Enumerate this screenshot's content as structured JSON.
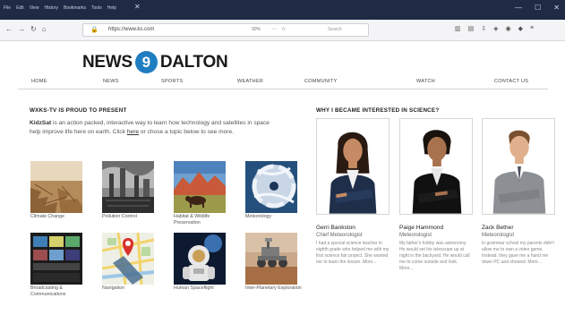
{
  "browser": {
    "menu": [
      "File",
      "Edit",
      "View",
      "History",
      "Bookmarks",
      "Tools",
      "Help"
    ],
    "url": "https://www.ks.com",
    "zoom": "90%",
    "search_placeholder": "Search"
  },
  "site": {
    "logo_word1": "NEWS",
    "logo_number": "9",
    "logo_word2": "DALTON",
    "nav": [
      "HOME",
      "NEWS",
      "SPORTS",
      "WEATHER",
      "COMMUNITY",
      "WATCH",
      "CONTACT US"
    ]
  },
  "left": {
    "heading": "WXKS-TV IS PROUD TO PRESENT",
    "intro_bold": "KidzSat",
    "intro_1": " is an action packed, interactive way to learn how technology and satellites in space help improve life here on earth. Click ",
    "intro_link": "here",
    "intro_2": " or chose a topic below to see more.",
    "topics": [
      {
        "label": "Climate Change"
      },
      {
        "label": "Pollution Control"
      },
      {
        "label": "Habitat & Wildlife Preservation"
      },
      {
        "label": "Meteorology"
      },
      {
        "label": "Broadcasting & Communications"
      },
      {
        "label": "Navigation"
      },
      {
        "label": "Human Spaceflight"
      },
      {
        "label": "Inter-Planetary Exploration"
      }
    ]
  },
  "right": {
    "heading": "WHY I BECAME INTERESTED IN SCIENCE?",
    "people": [
      {
        "name": "Gerri Bankston",
        "title": "Chief Meteorologist",
        "bio": "I had a special science teacher in eighth grade who helped me with my first science fair project. She wanted me to learn the lesson. More..."
      },
      {
        "name": "Paige Hammond",
        "title": "Meteorologist",
        "bio": "My father's hobby was astronomy. He would set his telescope up at night in the backyard. He would call me to come outside and look. More..."
      },
      {
        "name": "Zack Bether",
        "title": "Meteorologist",
        "bio": "In grammar school my parents didn't allow me to own a video game. Instead, they gave me a hand me down PC and showed. More..."
      }
    ]
  }
}
